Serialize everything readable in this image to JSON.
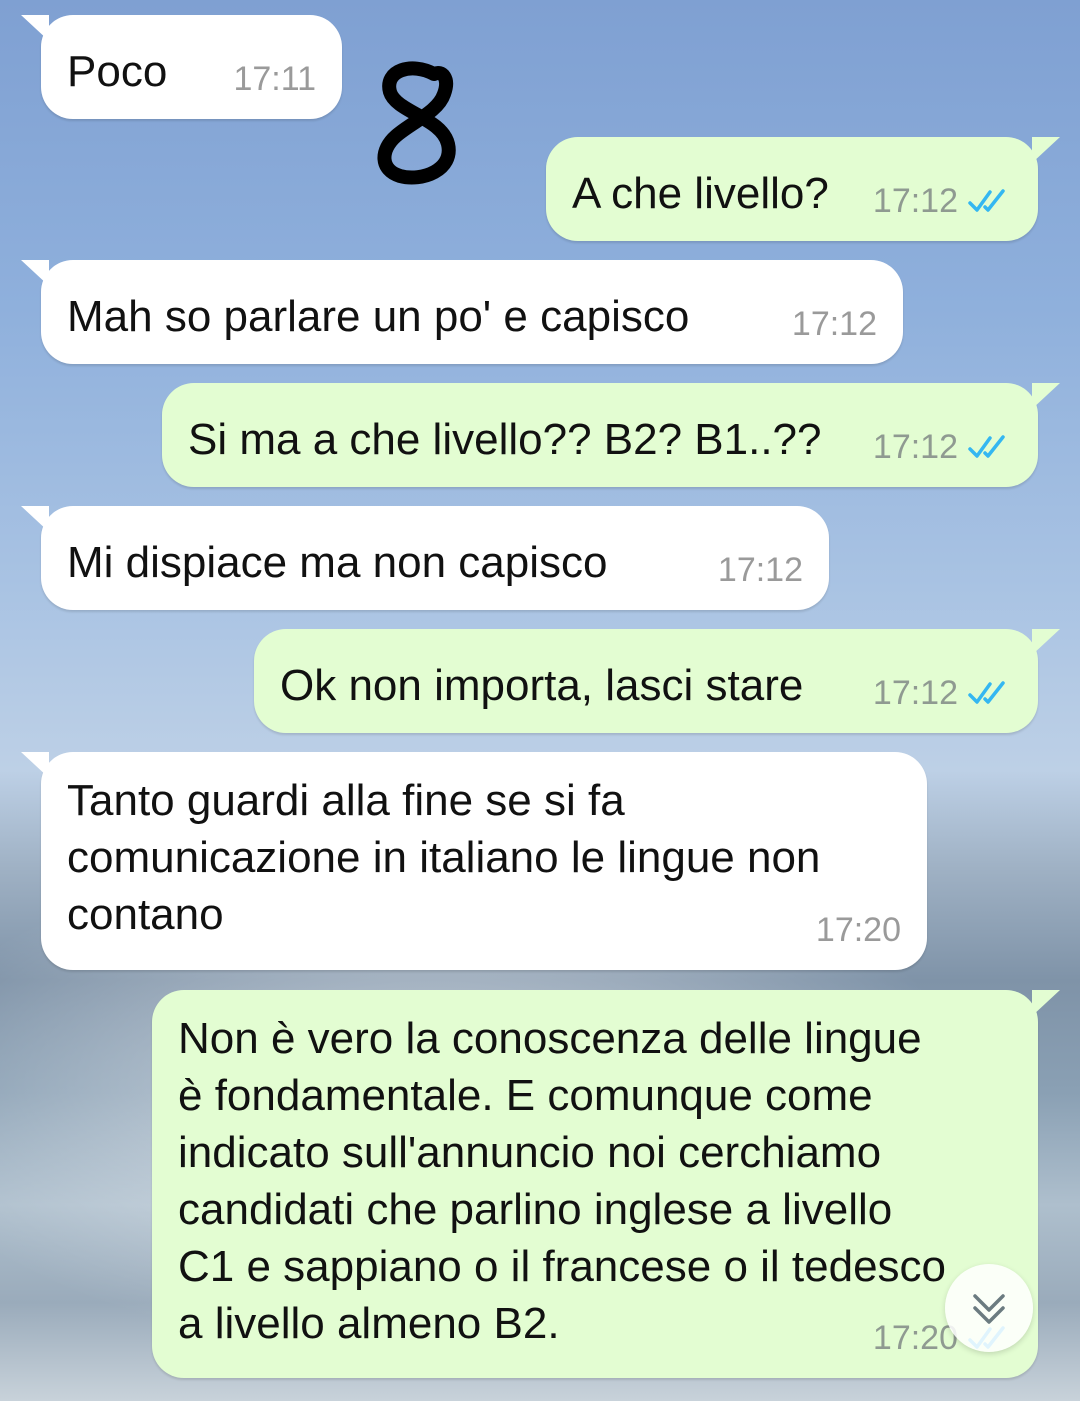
{
  "messages": [
    {
      "direction": "incoming",
      "text": "Poco",
      "time": "17:11"
    },
    {
      "direction": "outgoing",
      "text": "A che livello?",
      "time": "17:12",
      "status": "read"
    },
    {
      "direction": "incoming",
      "text": "Mah so parlare un po' e capisco",
      "time": "17:12"
    },
    {
      "direction": "outgoing",
      "text": "Si ma a che livello?? B2? B1..??",
      "time": "17:12",
      "status": "read"
    },
    {
      "direction": "incoming",
      "text": "Mi dispiace ma non capisco",
      "time": "17:12"
    },
    {
      "direction": "outgoing",
      "text": "Ok non importa, lasci stare",
      "time": "17:12",
      "status": "read"
    },
    {
      "direction": "incoming",
      "text": "Tanto guardi alla fine se si fa\ncomunicazione in italiano le lingue non\ncontano",
      "time": "17:20"
    },
    {
      "direction": "outgoing",
      "text": "Non è vero la conoscenza delle lingue\nè fondamentale. E comunque come\nindicato sull'annuncio noi cerchiamo\ncandidati che parlino inglese a livello\nC1 e sappiano o il francese o il tedesco\na livello almeno B2.",
      "time": "17:20",
      "status": "read"
    }
  ],
  "colors": {
    "incoming_bubble": "#ffffff",
    "outgoing_bubble": "#e3fdd2",
    "read_ticks": "#34b7f1"
  },
  "icons": {
    "read_status": "double-check-icon",
    "scroll_down": "chevron-double-down-icon",
    "annotation": "hand-drawn-number-8"
  }
}
